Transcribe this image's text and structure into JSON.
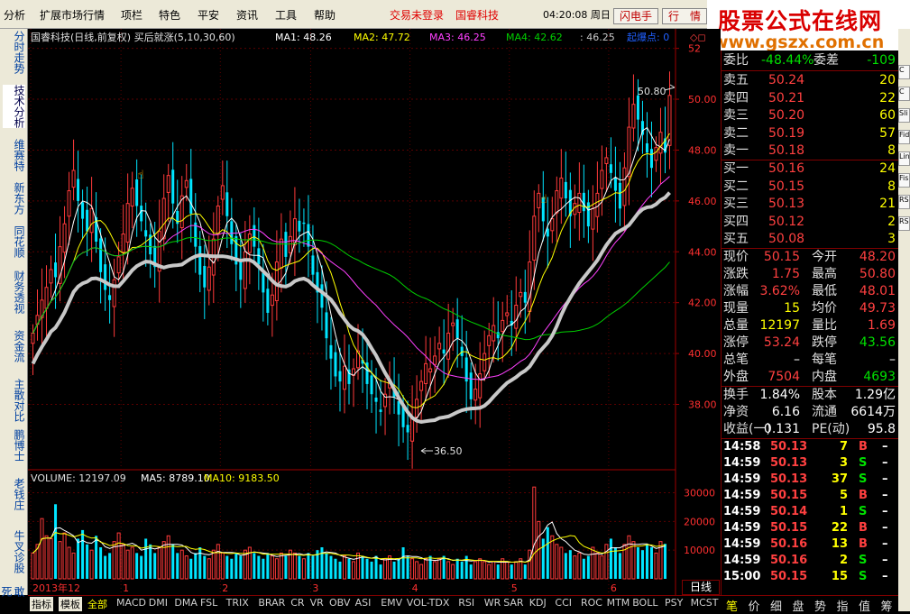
{
  "menu": {
    "items": [
      "分析",
      "扩展市场行情",
      "项栏",
      "特色",
      "平安",
      "资讯",
      "工具",
      "帮助"
    ],
    "status_login": "交易未登录",
    "stock_name": "国睿科技",
    "clock": "04:20:08 周日",
    "flash_button": "闪电手",
    "quote_button": "行　情"
  },
  "watermark": {
    "line1": "股票公式在线网",
    "line2": "www.gszx.com.cn"
  },
  "left_tabs": [
    "分时走势",
    "技术分析",
    "维赛特",
    "新东方",
    "同花顺",
    "财务透视",
    "资金流",
    "主散对比",
    "鹏博士",
    "老钱庄",
    "牛叉诊股",
    "敢死"
  ],
  "left_tab_active": 1,
  "chart_header": {
    "title": "国睿科技(日线,前复权) 买后就涨(5,10,30,60)",
    "ma1": "MA1: 48.26",
    "ma2": "MA2: 47.72",
    "ma3": "MA3: 46.25",
    "ma4": "MA4: 42.62",
    "val": ": 46.25",
    "signal": "起爆点: 0",
    "icons": "◇◻"
  },
  "volume_header": {
    "label": "VOLUME: 12197.09",
    "ma5": "MA5: 8789.10",
    "ma10": "MA10: 9183.50"
  },
  "annotations": {
    "high": "50.80",
    "low": "36.50"
  },
  "period_label": "日线",
  "colors": {
    "up": "#ff3a3a",
    "down": "#00e5ff",
    "ma1": "#ffffff",
    "ma2": "#ffff00",
    "ma3": "#ff40ff",
    "ma4": "#00d000",
    "thick": "#c8c8c8"
  },
  "chart_data": {
    "type": "candlestick",
    "price_axis": {
      "ticks": [
        "52",
        "50.00",
        "48.00",
        "46.00",
        "44.00",
        "42.00",
        "40.00",
        "38.00"
      ],
      "ylim": [
        35.5,
        52.2
      ]
    },
    "volume_axis": {
      "ticks": [
        "30000",
        "20000",
        "10000"
      ],
      "ylim": [
        0,
        33000
      ]
    },
    "x_labels": [
      "2013年12",
      "1",
      "2",
      "3",
      "4",
      "5",
      "6"
    ],
    "closes": [
      40.8,
      41.5,
      42.1,
      42.6,
      43.3,
      43.0,
      44.2,
      45.1,
      46.4,
      47.2,
      46.0,
      45.3,
      44.8,
      45.7,
      44.4,
      43.2,
      42.5,
      42.1,
      42.9,
      43.8,
      44.7,
      45.9,
      46.5,
      45.8,
      45.2,
      44.6,
      43.9,
      43.4,
      44.8,
      46.1,
      47.0,
      45.9,
      45.1,
      46.2,
      46.8,
      45.5,
      44.2,
      43.1,
      42.6,
      43.4,
      44.5,
      45.8,
      46.6,
      45.4,
      44.3,
      43.5,
      42.9,
      44.0,
      44.7,
      44.2,
      43.5,
      42.4,
      41.6,
      42.3,
      43.6,
      44.5,
      43.8,
      44.6,
      45.3,
      44.8,
      45.1,
      44.2,
      43.1,
      42.4,
      41.8,
      40.6,
      39.8,
      39.1,
      38.9,
      39.5,
      38.8,
      39.4,
      40.1,
      39.6,
      38.8,
      38.4,
      38.1,
      37.7,
      38.4,
      38.9,
      38.3,
      37.6,
      37.1,
      36.9,
      37.5,
      38.2,
      38.9,
      39.6,
      39.4,
      39.9,
      40.4,
      40.0,
      40.8,
      41.2,
      40.6,
      39.9,
      38.9,
      38.2,
      38.6,
      39.2,
      40.0,
      40.7,
      41.1,
      40.6,
      41.3,
      41.6,
      41.1,
      41.9,
      42.4,
      42.0,
      43.6,
      45.4,
      46.3,
      45.2,
      44.6,
      45.3,
      46.4,
      46.9,
      46.1,
      45.4,
      45.9,
      46.3,
      45.6,
      45.0,
      45.7,
      46.3,
      47.2,
      47.7,
      47.1,
      46.4,
      45.7,
      47.3,
      48.9,
      49.8,
      49.2,
      48.6,
      47.9,
      47.3,
      48.1,
      48.7,
      47.9,
      50.15
    ],
    "volumes": [
      9000,
      12000,
      21000,
      15000,
      14000,
      26000,
      13000,
      16000,
      11000,
      9000,
      14000,
      17000,
      12000,
      10000,
      15000,
      11000,
      8000,
      9000,
      13000,
      16000,
      12000,
      10000,
      11000,
      9000,
      8000,
      14000,
      12000,
      9000,
      11000,
      13000,
      15000,
      12000,
      9000,
      10000,
      8000,
      7000,
      9000,
      11000,
      8000,
      7000,
      10000,
      12000,
      9000,
      8000,
      7000,
      9000,
      8000,
      10000,
      11000,
      9000,
      8000,
      7000,
      9000,
      8000,
      7000,
      9000,
      8000,
      10000,
      9000,
      8000,
      7000,
      9000,
      8000,
      10000,
      11000,
      9000,
      8000,
      7000,
      6000,
      8000,
      7000,
      6000,
      9000,
      8000,
      7000,
      6000,
      8000,
      5000,
      7000,
      8000,
      6000,
      7000,
      11000,
      8000,
      7000,
      6000,
      5000,
      7000,
      8000,
      6000,
      7000,
      8000,
      6000,
      5000,
      7000,
      6000,
      8000,
      5000,
      6000,
      7000,
      6000,
      5000,
      6000,
      5000,
      7000,
      6000,
      5000,
      6000,
      7000,
      5000,
      10000,
      32000,
      20000,
      14000,
      18000,
      15000,
      12000,
      11000,
      9000,
      10000,
      8000,
      9000,
      7000,
      8000,
      11000,
      9000,
      8000,
      12000,
      14000,
      11000,
      9000,
      12000,
      15000,
      13000,
      11000,
      10000,
      12000,
      11000,
      9000,
      13000,
      12197
    ]
  },
  "quote": {
    "header": {
      "label1": "委比",
      "val1": "-48.44%",
      "label2": "委差",
      "val2": "-109"
    },
    "asks": [
      {
        "label": "卖五",
        "price": "50.24",
        "vol": "20"
      },
      {
        "label": "卖四",
        "price": "50.21",
        "vol": "22"
      },
      {
        "label": "卖三",
        "price": "50.20",
        "vol": "60"
      },
      {
        "label": "卖二",
        "price": "50.19",
        "vol": "57"
      },
      {
        "label": "卖一",
        "price": "50.18",
        "vol": "8"
      }
    ],
    "bids": [
      {
        "label": "买一",
        "price": "50.16",
        "vol": "24"
      },
      {
        "label": "买二",
        "price": "50.15",
        "vol": "8"
      },
      {
        "label": "买三",
        "price": "50.13",
        "vol": "21"
      },
      {
        "label": "买四",
        "price": "50.12",
        "vol": "2"
      },
      {
        "label": "买五",
        "price": "50.08",
        "vol": "3"
      }
    ],
    "stats": [
      {
        "l1": "现价",
        "v1": "50.15",
        "c1": "r",
        "l2": "今开",
        "v2": "48.20",
        "c2": "r"
      },
      {
        "l1": "涨跌",
        "v1": "1.75",
        "c1": "r",
        "l2": "最高",
        "v2": "50.80",
        "c2": "r"
      },
      {
        "l1": "涨幅",
        "v1": "3.62%",
        "c1": "r",
        "l2": "最低",
        "v2": "48.01",
        "c2": "r"
      },
      {
        "l1": "现量",
        "v1": "15",
        "c1": "y",
        "l2": "均价",
        "v2": "49.73",
        "c2": "r"
      },
      {
        "l1": "总量",
        "v1": "12197",
        "c1": "y",
        "l2": "量比",
        "v2": "1.69",
        "c2": "r"
      },
      {
        "l1": "涨停",
        "v1": "53.24",
        "c1": "r",
        "l2": "跌停",
        "v2": "43.56",
        "c2": "g"
      },
      {
        "l1": "总笔",
        "v1": "–",
        "c1": "w",
        "l2": "每笔",
        "v2": "–",
        "c2": "w"
      },
      {
        "l1": "外盘",
        "v1": "7504",
        "c1": "r",
        "l2": "内盘",
        "v2": "4693",
        "c2": "g"
      }
    ],
    "fundamentals": [
      {
        "l1": "换手",
        "v1": "1.84%",
        "l2": "股本",
        "v2": "1.29亿"
      },
      {
        "l1": "净资",
        "v1": "6.16",
        "l2": "流通",
        "v2": "6614万"
      },
      {
        "l1": "收益(一)",
        "v1": "0.131",
        "l2": "PE(动)",
        "v2": "95.8"
      }
    ],
    "ticks": [
      {
        "time": "14:58",
        "price": "50.13",
        "vol": "7",
        "bs": "B"
      },
      {
        "time": "14:59",
        "price": "50.13",
        "vol": "3",
        "bs": "S"
      },
      {
        "time": "14:59",
        "price": "50.13",
        "vol": "37",
        "bs": "S"
      },
      {
        "time": "14:59",
        "price": "50.15",
        "vol": "5",
        "bs": "B"
      },
      {
        "time": "14:59",
        "price": "50.14",
        "vol": "1",
        "bs": "S"
      },
      {
        "time": "14:59",
        "price": "50.15",
        "vol": "22",
        "bs": "B"
      },
      {
        "time": "14:59",
        "price": "50.16",
        "vol": "13",
        "bs": "B"
      },
      {
        "time": "14:59",
        "price": "50.16",
        "vol": "2",
        "bs": "S"
      },
      {
        "time": "15:00",
        "price": "50.15",
        "vol": "15",
        "bs": "S"
      }
    ],
    "tick_trail": "–"
  },
  "indicator_tabs": [
    "指标",
    "模板",
    "全部",
    "MACD",
    "DMI",
    "DMA",
    "FSL",
    "TRIX",
    "BRAR",
    "CR",
    "VR",
    "OBV",
    "ASI",
    "EMV",
    "VOL-TDX",
    "RSI",
    "WR",
    "SAR",
    "KDJ",
    "CCI",
    "ROC",
    "MTM",
    "BOLL",
    "PSY",
    "MCST"
  ],
  "right_bottom_tabs": [
    "笔",
    "价",
    "细",
    "盘",
    "势",
    "指",
    "值",
    "筹"
  ],
  "right_strip": [
    "C",
    "C",
    "Sli",
    "Fid",
    "Lin",
    "Fis",
    "RS",
    "RS"
  ]
}
